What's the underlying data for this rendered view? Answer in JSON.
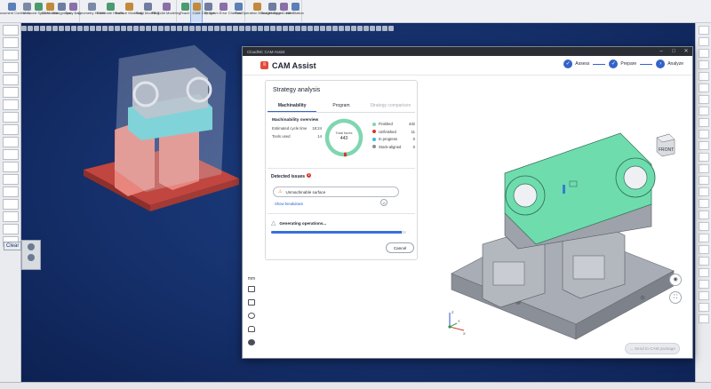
{
  "ribbon": {
    "groups": [
      [
        "Document Control",
        "View",
        "Coord System",
        "C3 Models",
        "Workgroups",
        "Body Bag"
      ],
      [
        "Geometry Health",
        "Electrode Health",
        "Surface Modeling",
        "Solid Modeling",
        "FB Solid Modeling"
      ],
      [
        "Teach",
        "CAM",
        "Clip Set",
        "Program Error Checker",
        "Post"
      ],
      [
        "Operation Manager",
        "Tool Manager",
        "Sync Control",
        "Net Station"
      ]
    ],
    "active": "CAM"
  },
  "viewport": {
    "clear_label": "Clear"
  },
  "dialog": {
    "window_title": "CloudNC CAM Assist",
    "app_title": "CAM Assist",
    "steps": [
      {
        "label": "Assess",
        "mark": "✓"
      },
      {
        "label": "Prepare",
        "mark": "✓"
      },
      {
        "label": "Analyze",
        "mark": "›"
      }
    ],
    "sidebar": {
      "unit": "mm"
    },
    "strategy": {
      "title": "Strategy analysis",
      "tabs": [
        "Machinability",
        "Program",
        "Strategy comparison"
      ],
      "machinability": {
        "heading": "Machinability overview",
        "rows": [
          {
            "label": "Estimated cycle time",
            "value": "18:24"
          },
          {
            "label": "Tools used",
            "value": "14"
          }
        ],
        "donut": {
          "label": "Total faces",
          "total": "443"
        },
        "legend": [
          {
            "label": "Finished",
            "count": "432",
            "value": 432,
            "color": "#7fd6b0"
          },
          {
            "label": "Unfinished",
            "count": "11",
            "value": 11,
            "color": "#d9352b"
          },
          {
            "label": "In progress",
            "count": "0",
            "value": 0,
            "color": "#3fb7e0"
          },
          {
            "label": "Stock-aligned",
            "count": "0",
            "value": 0,
            "color": "#8a8f98"
          }
        ]
      },
      "issues": {
        "heading": "Detected issues",
        "count": "1",
        "items": [
          "Unmachinable surface"
        ],
        "show_breakdown": "Show breakdown"
      },
      "generating": {
        "label": "Generating operations...",
        "progress": 0.97,
        "cancel": "Cancel"
      }
    },
    "send_button": "Send to CAM package",
    "view_cube_label": "FRONT",
    "axes": {
      "x": "X",
      "y": "Y",
      "z": "Z"
    }
  },
  "colors": {
    "accent": "#3563c9",
    "model_green": "#6fdcae",
    "model_grey": "#9a9ea6",
    "model_red": "#d9544b"
  }
}
